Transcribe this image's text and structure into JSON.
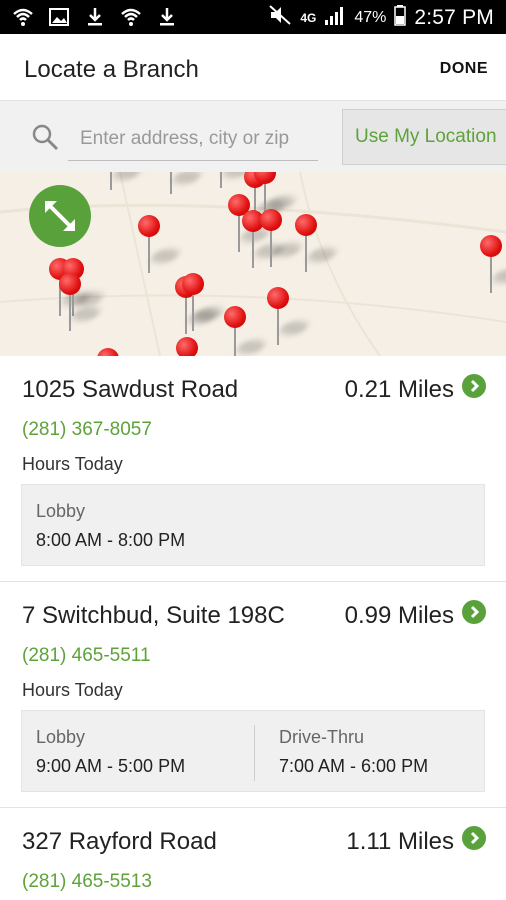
{
  "status_bar": {
    "battery": "47%",
    "network": "4G",
    "time": "2:57 PM"
  },
  "app_bar": {
    "title": "Locate a Branch",
    "done_label": "DONE"
  },
  "search": {
    "placeholder": "Enter address, city or zip",
    "value": "",
    "use_location_label": "Use My Location"
  },
  "map": {
    "pin_color": "#e01010",
    "expand_button_color": "#59a23b"
  },
  "branches": [
    {
      "name": "1025 Sawdust Road",
      "distance": "0.21 Miles",
      "phone": "(281) 367-8057",
      "hours_label": "Hours Today",
      "hours": [
        {
          "type": "Lobby",
          "time": "8:00 AM - 8:00 PM"
        }
      ]
    },
    {
      "name": "7 Switchbud, Suite 198C",
      "distance": "0.99 Miles",
      "phone": "(281) 465-5511",
      "hours_label": "Hours Today",
      "hours": [
        {
          "type": "Lobby",
          "time": "9:00 AM - 5:00 PM"
        },
        {
          "type": "Drive-Thru",
          "time": "7:00 AM - 6:00 PM"
        }
      ]
    },
    {
      "name": "327 Rayford Road",
      "distance": "1.11 Miles",
      "phone": "(281) 465-5513"
    }
  ],
  "colors": {
    "accent_green": "#5ea23a",
    "status_bar": "#000000"
  }
}
